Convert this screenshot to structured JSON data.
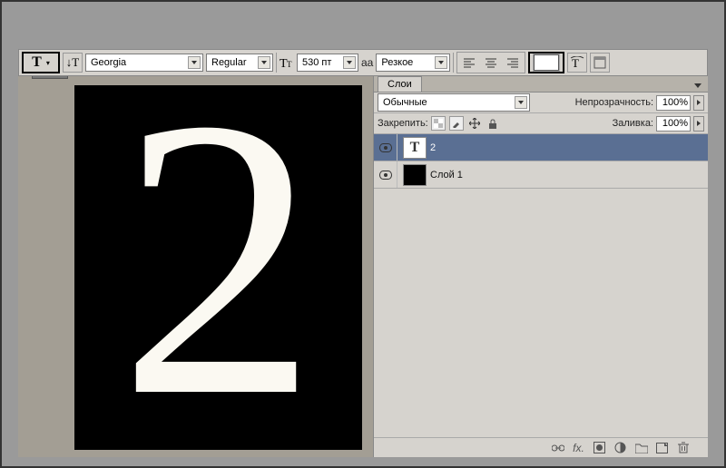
{
  "toolbar": {
    "tool": "T",
    "font_family": "Georgia",
    "font_style": "Regular",
    "font_size_label": "T",
    "font_size": "530 пт",
    "aa_label": "aa",
    "antialias": "Резкое",
    "color": "#ffffff"
  },
  "canvas": {
    "text": "2",
    "bg": "#000000",
    "fg": "#fbf9f2"
  },
  "layers_panel": {
    "tab": "Слои",
    "blend_mode": "Обычные",
    "opacity_label": "Непрозрачность:",
    "opacity": "100%",
    "lock_label": "Закрепить:",
    "fill_label": "Заливка:",
    "fill": "100%",
    "layers": [
      {
        "name": "2",
        "type": "text",
        "visible": true,
        "active": true
      },
      {
        "name": "Слой 1",
        "type": "raster",
        "visible": true,
        "active": false,
        "thumb": "black"
      }
    ]
  }
}
